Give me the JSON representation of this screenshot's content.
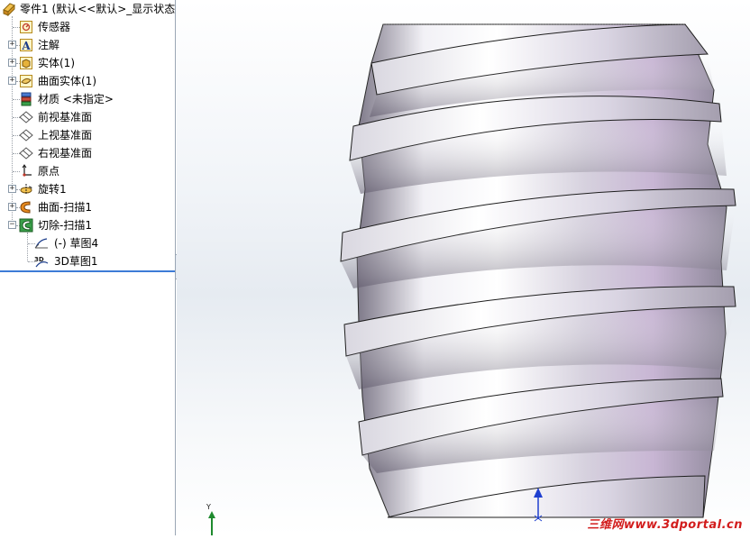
{
  "tree": {
    "root": {
      "label": "零件1  (默认<<默认>_显示状态",
      "icon": "part-icon"
    },
    "items": [
      {
        "label": "传感器",
        "icon": "sensor-icon",
        "expandable": false
      },
      {
        "label": "注解",
        "icon": "annotation-icon",
        "expandable": true
      },
      {
        "label": "实体(1)",
        "icon": "solid-body-icon",
        "expandable": true
      },
      {
        "label": "曲面实体(1)",
        "icon": "surface-body-icon",
        "expandable": true
      },
      {
        "label": "材质 <未指定>",
        "icon": "material-icon",
        "expandable": false
      },
      {
        "label": "前视基准面",
        "icon": "plane-icon",
        "expandable": false
      },
      {
        "label": "上视基准面",
        "icon": "plane-icon",
        "expandable": false
      },
      {
        "label": "右视基准面",
        "icon": "plane-icon",
        "expandable": false
      },
      {
        "label": "原点",
        "icon": "origin-icon",
        "expandable": false
      },
      {
        "label": "旋转1",
        "icon": "revolve-icon",
        "expandable": true
      },
      {
        "label": "曲面-扫描1",
        "icon": "surface-sweep-icon",
        "expandable": true
      },
      {
        "label": "切除-扫描1",
        "icon": "cut-sweep-icon",
        "expandable": true,
        "expanded": true
      },
      {
        "label": "(-) 草图4",
        "icon": "sketch-icon",
        "child": true
      },
      {
        "label": "3D草图1",
        "icon": "3d-sketch-icon",
        "child": true
      }
    ]
  },
  "viewport": {
    "triad_axis": "Y",
    "watermark": "三维网www.3dportal.cn"
  },
  "colors": {
    "accent": "#3d7bd6",
    "model_face": "#b9b4c4",
    "model_highlight": "#ffffff",
    "watermark": "#d21c1c"
  }
}
